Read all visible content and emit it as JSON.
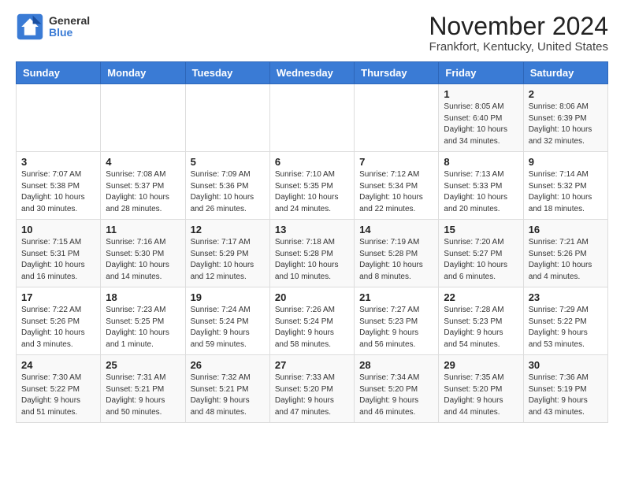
{
  "header": {
    "logo": {
      "general": "General",
      "blue": "Blue"
    },
    "title": "November 2024",
    "subtitle": "Frankfort, Kentucky, United States"
  },
  "weekdays": [
    "Sunday",
    "Monday",
    "Tuesday",
    "Wednesday",
    "Thursday",
    "Friday",
    "Saturday"
  ],
  "weeks": [
    [
      {
        "day": "",
        "info": ""
      },
      {
        "day": "",
        "info": ""
      },
      {
        "day": "",
        "info": ""
      },
      {
        "day": "",
        "info": ""
      },
      {
        "day": "",
        "info": ""
      },
      {
        "day": "1",
        "info": "Sunrise: 8:05 AM\nSunset: 6:40 PM\nDaylight: 10 hours and 34 minutes."
      },
      {
        "day": "2",
        "info": "Sunrise: 8:06 AM\nSunset: 6:39 PM\nDaylight: 10 hours and 32 minutes."
      }
    ],
    [
      {
        "day": "3",
        "info": "Sunrise: 7:07 AM\nSunset: 5:38 PM\nDaylight: 10 hours and 30 minutes."
      },
      {
        "day": "4",
        "info": "Sunrise: 7:08 AM\nSunset: 5:37 PM\nDaylight: 10 hours and 28 minutes."
      },
      {
        "day": "5",
        "info": "Sunrise: 7:09 AM\nSunset: 5:36 PM\nDaylight: 10 hours and 26 minutes."
      },
      {
        "day": "6",
        "info": "Sunrise: 7:10 AM\nSunset: 5:35 PM\nDaylight: 10 hours and 24 minutes."
      },
      {
        "day": "7",
        "info": "Sunrise: 7:12 AM\nSunset: 5:34 PM\nDaylight: 10 hours and 22 minutes."
      },
      {
        "day": "8",
        "info": "Sunrise: 7:13 AM\nSunset: 5:33 PM\nDaylight: 10 hours and 20 minutes."
      },
      {
        "day": "9",
        "info": "Sunrise: 7:14 AM\nSunset: 5:32 PM\nDaylight: 10 hours and 18 minutes."
      }
    ],
    [
      {
        "day": "10",
        "info": "Sunrise: 7:15 AM\nSunset: 5:31 PM\nDaylight: 10 hours and 16 minutes."
      },
      {
        "day": "11",
        "info": "Sunrise: 7:16 AM\nSunset: 5:30 PM\nDaylight: 10 hours and 14 minutes."
      },
      {
        "day": "12",
        "info": "Sunrise: 7:17 AM\nSunset: 5:29 PM\nDaylight: 10 hours and 12 minutes."
      },
      {
        "day": "13",
        "info": "Sunrise: 7:18 AM\nSunset: 5:28 PM\nDaylight: 10 hours and 10 minutes."
      },
      {
        "day": "14",
        "info": "Sunrise: 7:19 AM\nSunset: 5:28 PM\nDaylight: 10 hours and 8 minutes."
      },
      {
        "day": "15",
        "info": "Sunrise: 7:20 AM\nSunset: 5:27 PM\nDaylight: 10 hours and 6 minutes."
      },
      {
        "day": "16",
        "info": "Sunrise: 7:21 AM\nSunset: 5:26 PM\nDaylight: 10 hours and 4 minutes."
      }
    ],
    [
      {
        "day": "17",
        "info": "Sunrise: 7:22 AM\nSunset: 5:26 PM\nDaylight: 10 hours and 3 minutes."
      },
      {
        "day": "18",
        "info": "Sunrise: 7:23 AM\nSunset: 5:25 PM\nDaylight: 10 hours and 1 minute."
      },
      {
        "day": "19",
        "info": "Sunrise: 7:24 AM\nSunset: 5:24 PM\nDaylight: 9 hours and 59 minutes."
      },
      {
        "day": "20",
        "info": "Sunrise: 7:26 AM\nSunset: 5:24 PM\nDaylight: 9 hours and 58 minutes."
      },
      {
        "day": "21",
        "info": "Sunrise: 7:27 AM\nSunset: 5:23 PM\nDaylight: 9 hours and 56 minutes."
      },
      {
        "day": "22",
        "info": "Sunrise: 7:28 AM\nSunset: 5:23 PM\nDaylight: 9 hours and 54 minutes."
      },
      {
        "day": "23",
        "info": "Sunrise: 7:29 AM\nSunset: 5:22 PM\nDaylight: 9 hours and 53 minutes."
      }
    ],
    [
      {
        "day": "24",
        "info": "Sunrise: 7:30 AM\nSunset: 5:22 PM\nDaylight: 9 hours and 51 minutes."
      },
      {
        "day": "25",
        "info": "Sunrise: 7:31 AM\nSunset: 5:21 PM\nDaylight: 9 hours and 50 minutes."
      },
      {
        "day": "26",
        "info": "Sunrise: 7:32 AM\nSunset: 5:21 PM\nDaylight: 9 hours and 48 minutes."
      },
      {
        "day": "27",
        "info": "Sunrise: 7:33 AM\nSunset: 5:20 PM\nDaylight: 9 hours and 47 minutes."
      },
      {
        "day": "28",
        "info": "Sunrise: 7:34 AM\nSunset: 5:20 PM\nDaylight: 9 hours and 46 minutes."
      },
      {
        "day": "29",
        "info": "Sunrise: 7:35 AM\nSunset: 5:20 PM\nDaylight: 9 hours and 44 minutes."
      },
      {
        "day": "30",
        "info": "Sunrise: 7:36 AM\nSunset: 5:19 PM\nDaylight: 9 hours and 43 minutes."
      }
    ]
  ]
}
